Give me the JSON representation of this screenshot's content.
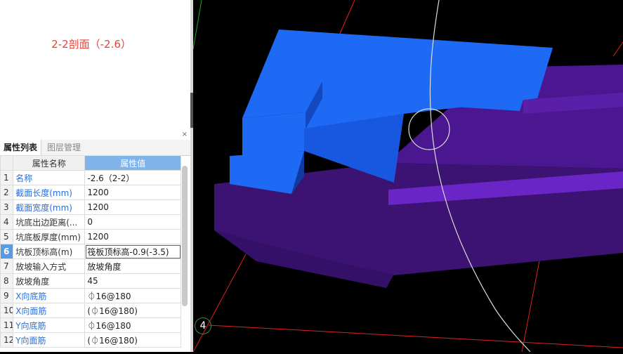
{
  "preview": {
    "title": "2-2剖面（-2.6）",
    "close_glyph": "×"
  },
  "tabs": [
    {
      "label": "属性列表"
    },
    {
      "label": "图层管理"
    }
  ],
  "table": {
    "headers": {
      "num": "",
      "name": "属性名称",
      "value": "属性值"
    },
    "rows": [
      {
        "num": "1",
        "name": "名称",
        "value": "-2.6（2-2）",
        "blue": true
      },
      {
        "num": "2",
        "name": "截面长度(mm)",
        "value": "1200",
        "blue": true
      },
      {
        "num": "3",
        "name": "截面宽度(mm)",
        "value": "1200",
        "blue": true
      },
      {
        "num": "4",
        "name": "坑底出边距离(...",
        "value": "0",
        "blue": false
      },
      {
        "num": "5",
        "name": "坑底板厚度(mm)",
        "value": "1200",
        "blue": false
      },
      {
        "num": "6",
        "name": "坑板顶标高(m)",
        "value": "筏板顶标高-0.9(-3.5)",
        "blue": false,
        "active": true
      },
      {
        "num": "7",
        "name": "放坡输入方式",
        "value": "放坡角度",
        "blue": false
      },
      {
        "num": "8",
        "name": "放坡角度",
        "value": "45",
        "blue": false
      },
      {
        "num": "9",
        "name": "X向底筋",
        "value": "⏀16@180",
        "blue": true
      },
      {
        "num": "10",
        "name": "X向面筋",
        "value": "(⏀16@180)",
        "blue": true
      },
      {
        "num": "11",
        "name": "Y向底筋",
        "value": "⏀16@180",
        "blue": true
      },
      {
        "num": "12",
        "name": "Y向面筋",
        "value": "(⏀16@180)",
        "blue": true
      }
    ]
  },
  "viewport": {
    "axis_marker": "4",
    "colors": {
      "blue_face": "#1e6af5",
      "blue_dark": "#1448c0",
      "purple_face": "#5a1fa8",
      "purple_dark": "#3c1272",
      "grid_red": "#e02020",
      "axis_green": "#1fa41f"
    }
  }
}
